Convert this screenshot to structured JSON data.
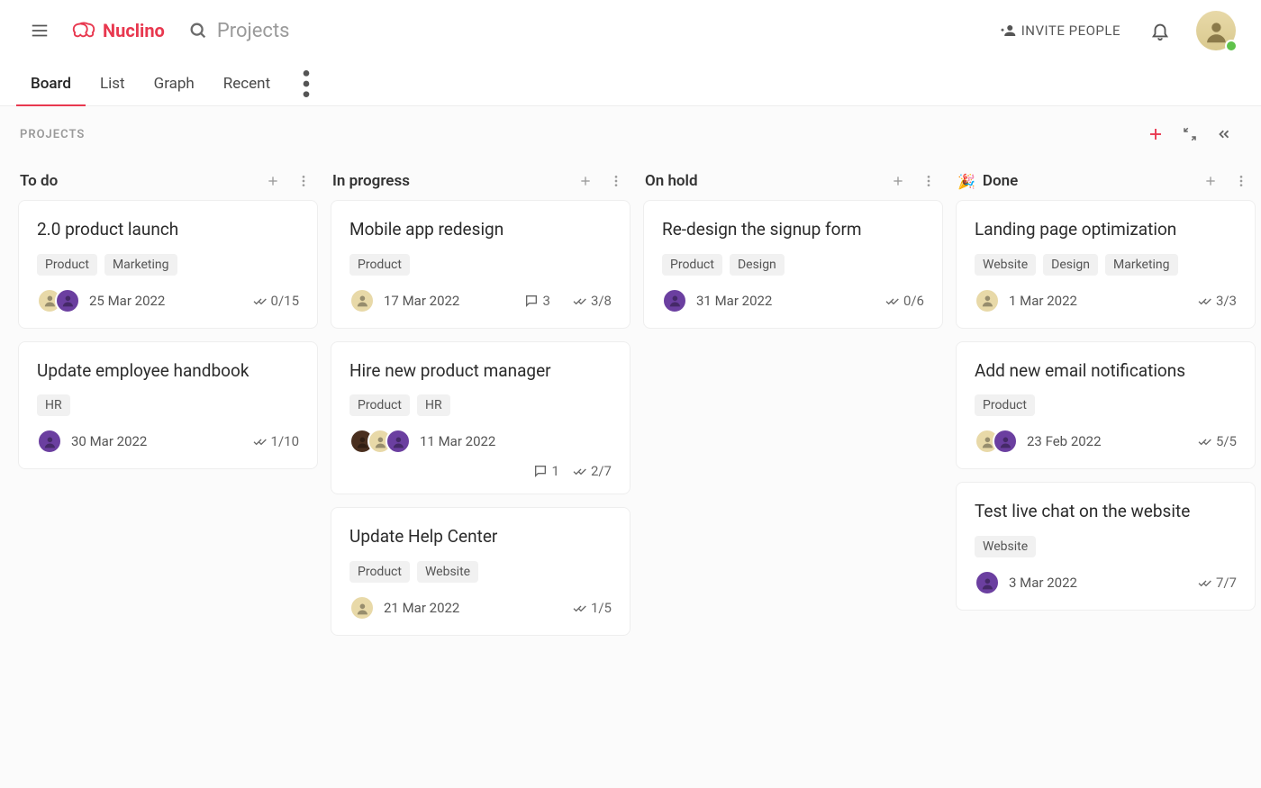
{
  "header": {
    "app_name": "Nuclino",
    "search_placeholder": "Projects",
    "invite_label": "INVITE PEOPLE"
  },
  "tabs": {
    "items": [
      "Board",
      "List",
      "Graph",
      "Recent"
    ],
    "active_index": 0
  },
  "board": {
    "title": "PROJECTS",
    "columns": [
      {
        "title": "To do",
        "emoji": "",
        "cards": [
          {
            "title": "2.0 product launch",
            "tags": [
              "Product",
              "Marketing"
            ],
            "avatars": [
              "#e8d9a8",
              "#6b3fa0"
            ],
            "date": "25 Mar 2022",
            "comments": "",
            "progress": "0/15"
          },
          {
            "title": "Update employee handbook",
            "tags": [
              "HR"
            ],
            "avatars": [
              "#6b3fa0"
            ],
            "date": "30 Mar 2022",
            "comments": "",
            "progress": "1/10"
          }
        ]
      },
      {
        "title": "In progress",
        "emoji": "",
        "cards": [
          {
            "title": "Mobile app redesign",
            "tags": [
              "Product"
            ],
            "avatars": [
              "#e8d9a8"
            ],
            "date": "17 Mar 2022",
            "comments": "3",
            "progress": "3/8"
          },
          {
            "title": "Hire new product manager",
            "tags": [
              "Product",
              "HR"
            ],
            "avatars": [
              "#4a2f1f",
              "#e8d9a8",
              "#6b3fa0"
            ],
            "date": "11 Mar 2022",
            "comments": "1",
            "progress": "2/7",
            "wrap": true
          },
          {
            "title": "Update Help Center",
            "tags": [
              "Product",
              "Website"
            ],
            "avatars": [
              "#e8d9a8"
            ],
            "date": "21 Mar 2022",
            "comments": "",
            "progress": "1/5"
          }
        ]
      },
      {
        "title": "On hold",
        "emoji": "",
        "cards": [
          {
            "title": "Re-design the signup form",
            "tags": [
              "Product",
              "Design"
            ],
            "avatars": [
              "#6b3fa0"
            ],
            "date": "31 Mar 2022",
            "comments": "",
            "progress": "0/6"
          }
        ]
      },
      {
        "title": "Done",
        "emoji": "🎉",
        "cards": [
          {
            "title": "Landing page optimization",
            "tags": [
              "Website",
              "Design",
              "Marketing"
            ],
            "avatars": [
              "#e8d9a8"
            ],
            "date": "1 Mar 2022",
            "comments": "",
            "progress": "3/3"
          },
          {
            "title": "Add new email notifications",
            "tags": [
              "Product"
            ],
            "avatars": [
              "#e8d9a8",
              "#6b3fa0"
            ],
            "date": "23 Feb 2022",
            "comments": "",
            "progress": "5/5"
          },
          {
            "title": "Test live chat on the website",
            "tags": [
              "Website"
            ],
            "avatars": [
              "#6b3fa0"
            ],
            "date": "3 Mar 2022",
            "comments": "",
            "progress": "7/7"
          }
        ]
      }
    ]
  }
}
